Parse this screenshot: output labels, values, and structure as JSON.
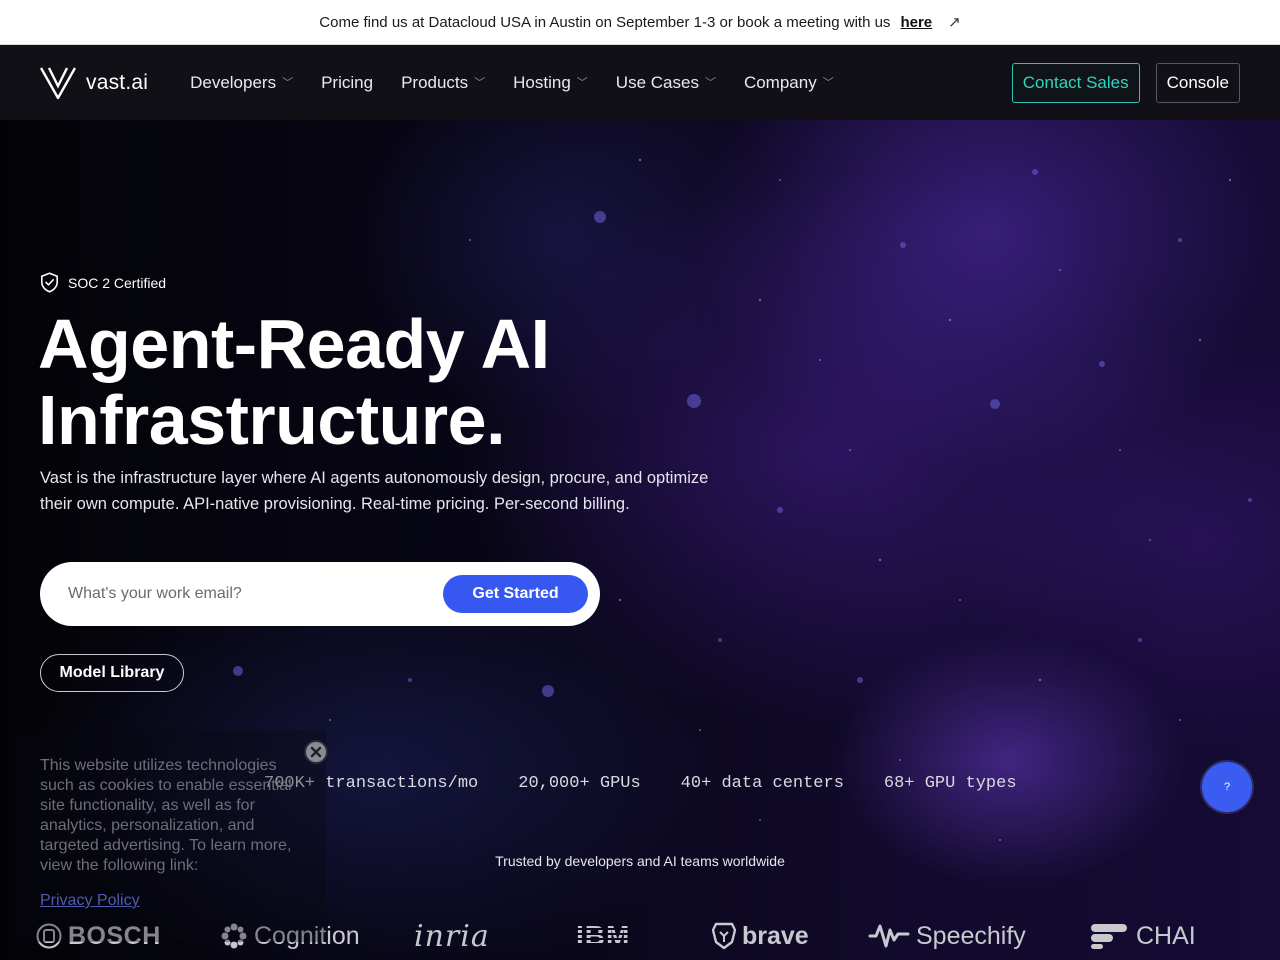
{
  "announcement": {
    "text": "Come find us at Datacloud USA in Austin on September 1-3 or book a meeting with us",
    "link_label": "here",
    "arrow_icon": "arrow-up-right-icon"
  },
  "header": {
    "brand": "vast.ai",
    "nav": [
      {
        "label": "Developers",
        "has_menu": true
      },
      {
        "label": "Pricing",
        "has_menu": false
      },
      {
        "label": "Products",
        "has_menu": true
      },
      {
        "label": "Hosting",
        "has_menu": true
      },
      {
        "label": "Use Cases",
        "has_menu": true
      },
      {
        "label": "Company",
        "has_menu": true
      }
    ],
    "contact_sales": "Contact Sales",
    "console": "Console"
  },
  "hero": {
    "badge": "SOC 2 Certified",
    "title_line1": "Agent-Ready AI",
    "title_line2": "Infrastructure.",
    "subtitle": "Vast is the infrastructure layer where AI agents autonomously design, procure, and optimize their own compute. API-native provisioning. Real-time pricing. Per-second billing.",
    "email_placeholder": "What's your work email?",
    "email_value": "",
    "cta": "Get Started",
    "model_library": "Model Library",
    "stats": [
      "700K+ transactions/mo",
      "20,000+ GPUs",
      "40+ data centers",
      "68+ GPU types"
    ],
    "trusted": "Trusted by developers and AI teams worldwide",
    "logos": [
      "BOSCH",
      "Cognition",
      "inria",
      "IBM",
      "brave",
      "Speechify",
      "CHAI"
    ]
  },
  "cookie": {
    "text": "This website utilizes technologies such as cookies to enable essential site functionality, as well as for analytics, personalization, and targeted advertising. To learn more, view the following link:",
    "link": "Privacy Policy",
    "close_icon": "close-icon"
  },
  "help_button": "?",
  "colors": {
    "accent_blue": "#3758f0",
    "teal": "#33d3c0",
    "header_bg": "#111016"
  }
}
